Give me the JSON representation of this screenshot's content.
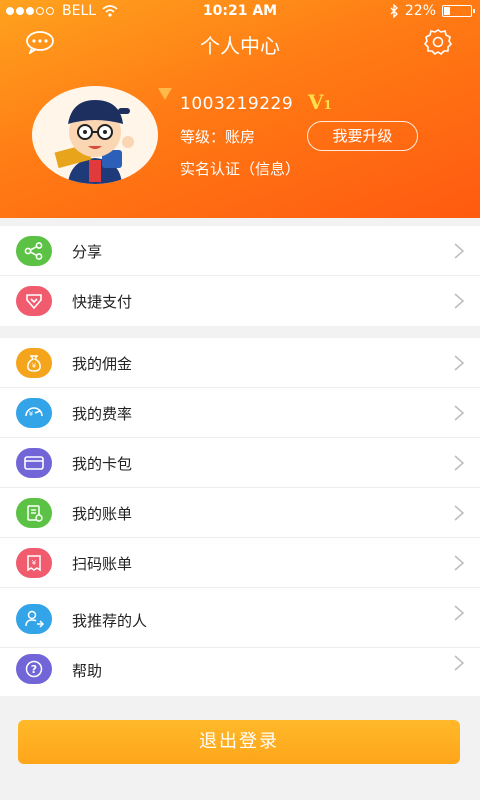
{
  "status_bar": {
    "carrier": "BELL",
    "time": "10:21 AM",
    "battery_text": "22%",
    "battery_level": 0.22
  },
  "navbar": {
    "title": "个人中心",
    "left_icon": "chat-bubble-icon",
    "right_icon": "gear-icon"
  },
  "profile": {
    "user_id": "1003219229",
    "vip_badge": "V",
    "vip_level": "1",
    "level_text": "等级：账房",
    "upgrade_label": "我要升级",
    "verify_text": "实名认证（信息）"
  },
  "menu_group_1": [
    {
      "label": "分享",
      "icon": "share-icon",
      "color": "#5cc245"
    },
    {
      "label": "快捷支付",
      "icon": "quick-pay-icon",
      "color": "#f05c6e"
    }
  ],
  "menu_group_2": [
    {
      "label": "我的佣金",
      "icon": "money-bag-icon",
      "color": "#f4a51c"
    },
    {
      "label": "我的费率",
      "icon": "rate-icon",
      "color": "#33a4e8"
    },
    {
      "label": "我的卡包",
      "icon": "wallet-icon",
      "color": "#7165d8"
    },
    {
      "label": "我的账单",
      "icon": "bill-icon",
      "color": "#5cc245"
    },
    {
      "label": "扫码账单",
      "icon": "scan-bill-icon",
      "color": "#f05c6e"
    },
    {
      "label": "我推荐的人",
      "icon": "referral-icon",
      "color": "#33a4e8"
    },
    {
      "label": "帮助",
      "icon": "help-icon",
      "color": "#7165d8"
    }
  ],
  "logout_label": "退出登录",
  "colors": {
    "header_start": "#ffa21e",
    "header_end": "#ff5a10",
    "logout": "#ffae22"
  }
}
